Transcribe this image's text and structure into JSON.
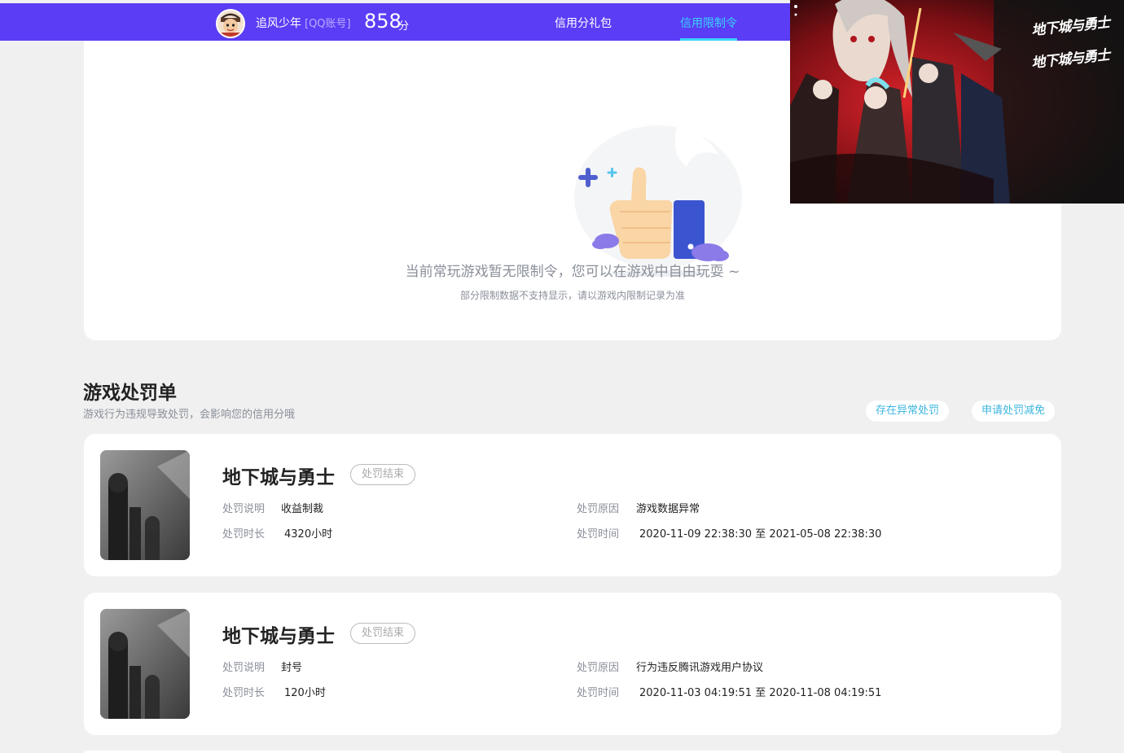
{
  "header": {
    "nickname": "追风少年",
    "account_type": "[QQ账号]",
    "score": "858",
    "score_unit": "分",
    "nav": [
      {
        "label": "信用分礼包",
        "active": false
      },
      {
        "label": "信用限制令",
        "active": true
      }
    ],
    "colors": {
      "bar": "#5b3df5",
      "active": "#38d4ff"
    }
  },
  "status": {
    "title": "当前常玩游戏暂无限制令，您可以在游戏中自由玩耍 ~",
    "subtitle": "部分限制数据不支持显示，请以游戏内限制记录为准"
  },
  "section": {
    "title": "游戏处罚单",
    "subtitle": "游戏行为违规导致处罚，会影响您的信用分哦",
    "buttons": [
      "存在异常处罚",
      "申请处罚减免"
    ]
  },
  "labels": {
    "desc": "处罚说明",
    "duration": "处罚时长",
    "reason": "处罚原因",
    "time": "处罚时间",
    "range_sep": "至"
  },
  "punishments": [
    {
      "game": "地下城与勇士",
      "status": "处罚结束",
      "desc": "收益制裁",
      "duration": "4320小时",
      "reason": "游戏数据异常",
      "start": "2020-11-09 22:38:30",
      "end": "2021-05-08 22:38:30"
    },
    {
      "game": "地下城与勇士",
      "status": "处罚结束",
      "desc": "封号",
      "duration": "120小时",
      "reason": "行为违反腾讯游戏用户协议",
      "start": "2020-11-03 04:19:51",
      "end": "2020-11-08 04:19:51"
    }
  ],
  "banner": {
    "logos": [
      "地下城与勇士",
      "地下城与勇士"
    ]
  }
}
